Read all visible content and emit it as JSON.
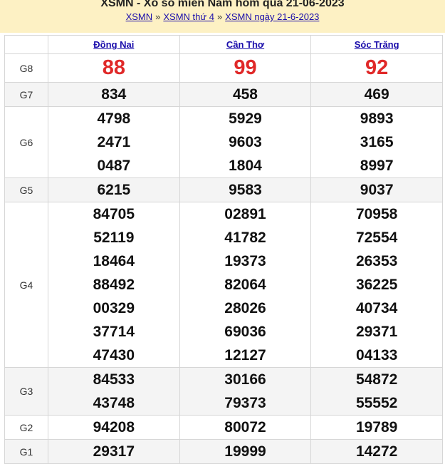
{
  "header": {
    "title": "XSMN - Xổ số miền Nam hôm qua 21-06-2023",
    "breadcrumbs": [
      "XSMN",
      "XSMN thứ 4",
      "XSMN ngày 21-6-2023"
    ],
    "separator": "»"
  },
  "provinces": [
    "Đồng Nai",
    "Cần Thơ",
    "Sóc Trăng"
  ],
  "prizes": [
    {
      "label": "G8",
      "values": [
        [
          "88"
        ],
        [
          "99"
        ],
        [
          "92"
        ]
      ]
    },
    {
      "label": "G7",
      "values": [
        [
          "834"
        ],
        [
          "458"
        ],
        [
          "469"
        ]
      ]
    },
    {
      "label": "G6",
      "values": [
        [
          "4798",
          "2471",
          "0487"
        ],
        [
          "5929",
          "9603",
          "1804"
        ],
        [
          "9893",
          "3165",
          "8997"
        ]
      ]
    },
    {
      "label": "G5",
      "values": [
        [
          "6215"
        ],
        [
          "9583"
        ],
        [
          "9037"
        ]
      ]
    },
    {
      "label": "G4",
      "values": [
        [
          "84705",
          "52119",
          "18464",
          "88492",
          "00329",
          "37714",
          "47430"
        ],
        [
          "02891",
          "41782",
          "19373",
          "82064",
          "28026",
          "69036",
          "12127"
        ],
        [
          "70958",
          "72554",
          "26353",
          "36225",
          "40734",
          "29371",
          "04133"
        ]
      ]
    },
    {
      "label": "G3",
      "values": [
        [
          "84533",
          "43748"
        ],
        [
          "30166",
          "79373"
        ],
        [
          "54872",
          "55552"
        ]
      ]
    },
    {
      "label": "G2",
      "values": [
        [
          "94208"
        ],
        [
          "80072"
        ],
        [
          "19789"
        ]
      ]
    },
    {
      "label": "G1",
      "values": [
        [
          "29317"
        ],
        [
          "19999"
        ],
        [
          "14272"
        ]
      ]
    }
  ],
  "colors": {
    "header_bg": "#fdf1c4",
    "special_prize": "#e02929",
    "link": "#1a0dab"
  }
}
